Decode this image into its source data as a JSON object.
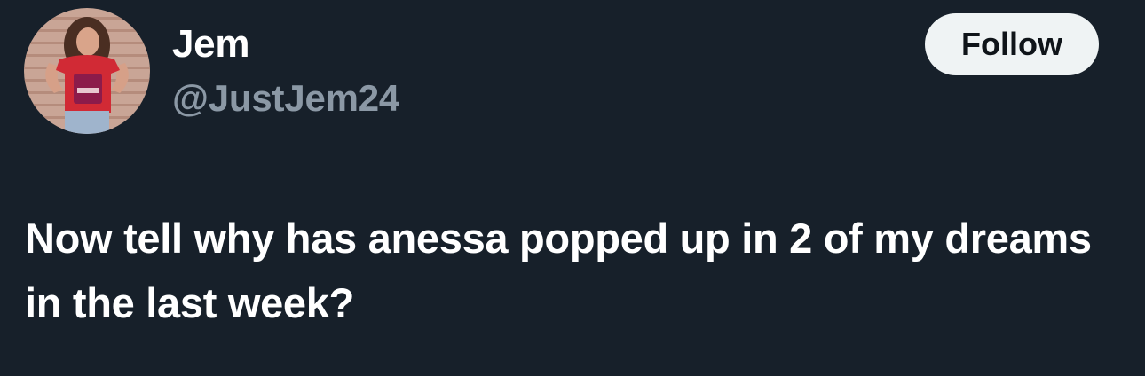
{
  "author": {
    "display_name": "Jem",
    "handle": "@JustJem24",
    "avatar_icon": "profile-photo"
  },
  "actions": {
    "follow_label": "Follow"
  },
  "tweet": {
    "text": "Now tell why has anessa popped up in 2 of my dreams in the last week?"
  },
  "colors": {
    "background": "#17202a",
    "text_primary": "#ffffff",
    "text_secondary": "#8b98a5",
    "button_bg": "#eff3f4",
    "button_text": "#0f1419"
  }
}
